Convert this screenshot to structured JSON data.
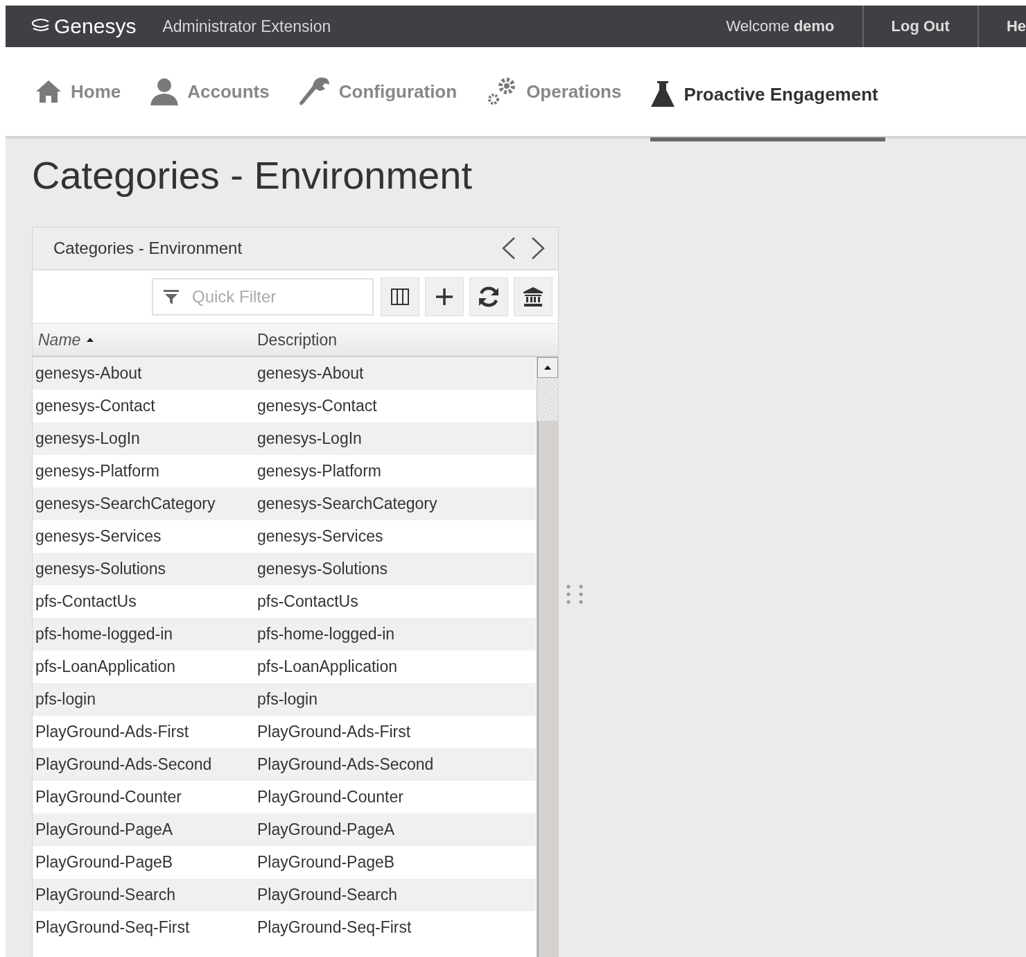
{
  "topbar": {
    "brand": "Genesys",
    "app_title": "Administrator Extension",
    "welcome": "Welcome **demo**",
    "actions": [
      "Log Out",
      "He"
    ]
  },
  "nav": [
    {
      "label": "Home",
      "selected": false
    },
    {
      "label": "Accounts",
      "selected": false
    },
    {
      "label": "Configuration",
      "selected": false
    },
    {
      "label": "Operations",
      "selected": false
    },
    {
      "label": "Proactive Engagement",
      "selected": true
    }
  ],
  "page_title": "Categories - Environment",
  "panel": {
    "title": "Categories - Environment",
    "filter": {
      "placeholder": "Quick Filter"
    },
    "columns": [
      {
        "label": "Name",
        "sorted": true
      },
      {
        "label": "Description",
        "sorted": false
      }
    ],
    "rows": [
      [
        "genesys-About",
        "genesys-About"
      ],
      [
        "genesys-Contact",
        "genesys-Contact"
      ],
      [
        "genesys-LogIn",
        "genesys-LogIn"
      ],
      [
        "genesys-Platform",
        "genesys-Platform"
      ],
      [
        "genesys-SearchCategory",
        "genesys-SearchCategory"
      ],
      [
        "genesys-Services",
        "genesys-Services"
      ],
      [
        "genesys-Solutions",
        "genesys-Solutions"
      ],
      [
        "pfs-ContactUs",
        "pfs-ContactUs"
      ],
      [
        "pfs-home-logged-in",
        "pfs-home-logged-in"
      ],
      [
        "pfs-LoanApplication",
        "pfs-LoanApplication"
      ],
      [
        "pfs-login",
        "pfs-login"
      ],
      [
        "PlayGround-Ads-First",
        "PlayGround-Ads-First"
      ],
      [
        "PlayGround-Ads-Second",
        "PlayGround-Ads-Second"
      ],
      [
        "PlayGround-Counter",
        "PlayGround-Counter"
      ],
      [
        "PlayGround-PageA",
        "PlayGround-PageA"
      ],
      [
        "PlayGround-PageB",
        "PlayGround-PageB"
      ],
      [
        "PlayGround-Search",
        "PlayGround-Search"
      ],
      [
        "PlayGround-Seq-First",
        "PlayGround-Seq-First"
      ]
    ]
  }
}
